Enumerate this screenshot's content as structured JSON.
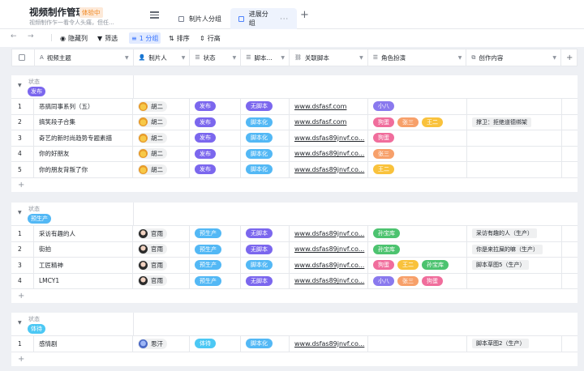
{
  "app": {
    "title": "视频制作管理",
    "badge": "体验中",
    "subtitle": "视频制作乍一看令人头痛，但任..."
  },
  "tabs": [
    {
      "label": "制片人分组",
      "active": false
    },
    {
      "label": "进展分组",
      "active": true
    }
  ],
  "toolbar": {
    "hide": "隐藏列",
    "filter": "筛选",
    "group": "1 分组",
    "sort": "排序",
    "row_height": "行高"
  },
  "columns": [
    "视频主题",
    "制片人",
    "状态",
    "脚本...",
    "关联脚本",
    "角色扮演",
    "创作内容"
  ],
  "colors": {
    "发布": "#7b67ee",
    "预生产": "#53b8f5",
    "体待": "#4cc8f4",
    "无脚本": "#7b67ee",
    "脚本化": "#53b8f5",
    "小八": "#8a79ee",
    "狗蛋": "#f06d9c",
    "张三": "#f7a06a",
    "王二": "#f9c23c",
    "孙宝库": "#4cc36f"
  },
  "groups": [
    {
      "label": "状态",
      "tag": "发布",
      "rows": [
        {
          "idx": "1",
          "topic": "恶搞同事系列（五）",
          "producer": "胡二",
          "avatar": "yellow",
          "status": "发布",
          "script": "无脚本",
          "link": "www.dsfasf.com",
          "roles": [
            "小八"
          ],
          "content": ""
        },
        {
          "idx": "2",
          "topic": "搞笑段子合集",
          "producer": "胡二",
          "avatar": "yellow",
          "status": "发布",
          "script": "脚本化",
          "link": "www.dsfasf.com",
          "roles": [
            "狗蛋",
            "张三",
            "王二"
          ],
          "content": "撑卫：拒绝道德绑架"
        },
        {
          "idx": "3",
          "topic": "奇艺的新时尚趋势专题素描",
          "producer": "胡二",
          "avatar": "yellow",
          "status": "发布",
          "script": "脚本化",
          "link": "www.dsfas89jnvf.co...",
          "roles": [
            "狗蛋"
          ],
          "content": ""
        },
        {
          "idx": "4",
          "topic": "你的好朋友",
          "producer": "胡二",
          "avatar": "yellow",
          "status": "发布",
          "script": "脚本化",
          "link": "www.dsfas89jnvf.co...",
          "roles": [
            "张三"
          ],
          "content": ""
        },
        {
          "idx": "5",
          "topic": "你的朋友背叛了你",
          "producer": "胡二",
          "avatar": "yellow",
          "status": "发布",
          "script": "脚本化",
          "link": "www.dsfas89jnvf.co...",
          "roles": [
            "王二"
          ],
          "content": ""
        }
      ]
    },
    {
      "label": "状态",
      "tag": "预生产",
      "rows": [
        {
          "idx": "1",
          "topic": "采访有趣的人",
          "producer": "官雨",
          "avatar": "dark",
          "status": "预生产",
          "script": "无脚本",
          "link": "www.dsfas89jnvf.co...",
          "roles": [
            "孙宝库"
          ],
          "content": "采访有趣的人（生产）"
        },
        {
          "idx": "2",
          "topic": "街拍",
          "producer": "官雨",
          "avatar": "dark",
          "status": "预生产",
          "script": "无脚本",
          "link": "www.dsfas89jnvf.co...",
          "roles": [
            "孙宝库"
          ],
          "content": "你是来拉屎的嘛（生产）"
        },
        {
          "idx": "3",
          "topic": "工匠精神",
          "producer": "官雨",
          "avatar": "dark",
          "status": "预生产",
          "script": "脚本化",
          "link": "www.dsfas89jnvf.co...",
          "roles": [
            "狗蛋",
            "王二",
            "孙宝库"
          ],
          "content": "脚本草图5（生产）"
        },
        {
          "idx": "4",
          "topic": "LMCY1",
          "producer": "官雨",
          "avatar": "dark",
          "status": "预生产",
          "script": "无脚本",
          "link": "www.dsfas89jnvf.co...",
          "roles": [
            "小八",
            "张三",
            "狗蛋"
          ],
          "content": ""
        }
      ]
    },
    {
      "label": "状态",
      "tag": "体待",
      "rows": [
        {
          "idx": "1",
          "topic": "感情剧",
          "producer": "思汗",
          "avatar": "blue",
          "status": "体待",
          "script": "脚本化",
          "link": "www.dsfas89jnvf.co...",
          "roles": [],
          "content": "脚本草图2（生产）"
        }
      ]
    }
  ]
}
